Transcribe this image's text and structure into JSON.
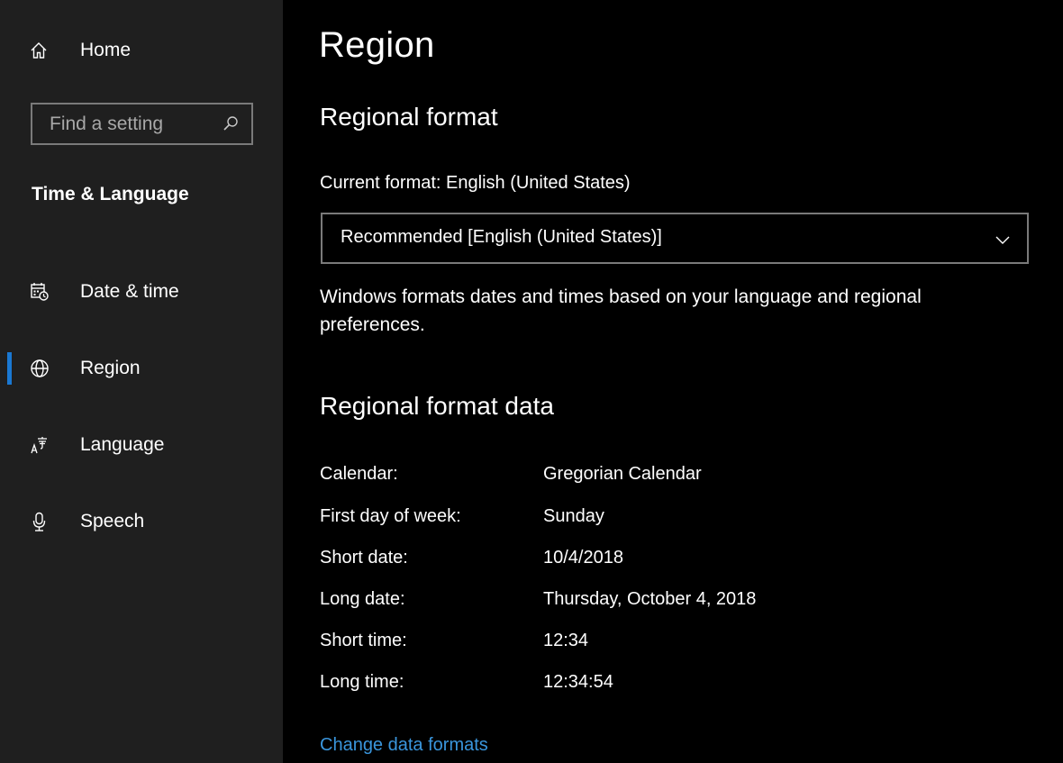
{
  "sidebar": {
    "home_label": "Home",
    "search_placeholder": "Find a setting",
    "section_heading": "Time & Language",
    "items": [
      {
        "label": "Date & time",
        "icon": "calendar-clock-icon",
        "selected": false
      },
      {
        "label": "Region",
        "icon": "globe-icon",
        "selected": true
      },
      {
        "label": "Language",
        "icon": "language-icon",
        "selected": false
      },
      {
        "label": "Speech",
        "icon": "microphone-icon",
        "selected": false
      }
    ]
  },
  "main": {
    "title": "Region",
    "regional_format": {
      "heading": "Regional format",
      "current_format_label": "Current format: English (United States)",
      "selected_value": "Recommended [English (United States)]",
      "description": "Windows formats dates and times based on your language and regional preferences."
    },
    "format_data": {
      "heading": "Regional format data",
      "rows": [
        {
          "key": "Calendar:",
          "value": "Gregorian Calendar"
        },
        {
          "key": "First day of week:",
          "value": "Sunday"
        },
        {
          "key": "Short date:",
          "value": "10/4/2018"
        },
        {
          "key": "Long date:",
          "value": "Thursday, October 4, 2018"
        },
        {
          "key": "Short time:",
          "value": "12:34"
        },
        {
          "key": "Long time:",
          "value": "12:34:54"
        }
      ]
    },
    "change_link": "Change data formats"
  },
  "colors": {
    "sidebar_bg": "#1f1f1f",
    "main_bg": "#000000",
    "accent": "#1a78d2",
    "link": "#3a96dd",
    "border": "#7a7a7a"
  }
}
